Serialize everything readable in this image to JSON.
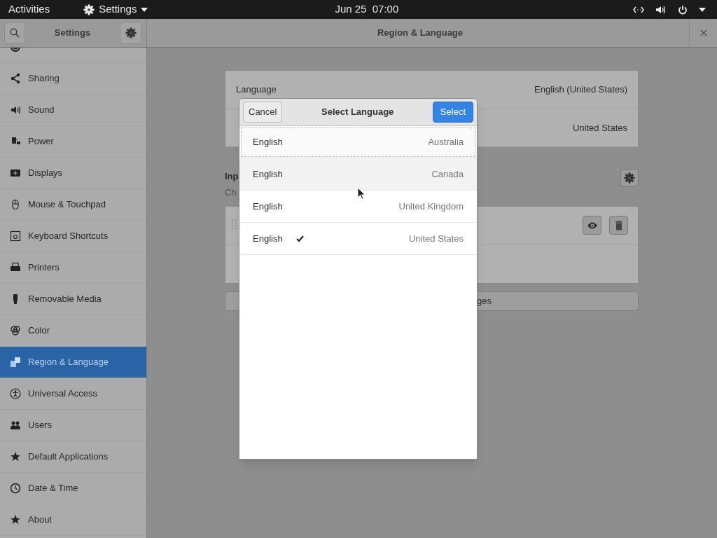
{
  "top_bar": {
    "activities": "Activities",
    "app_menu": "Settings",
    "clock": "Jun 25  07:00"
  },
  "header": {
    "sidebar_title": "Settings",
    "title": "Region & Language"
  },
  "sidebar": {
    "items": [
      {
        "label": "Sharing",
        "selected": false
      },
      {
        "label": "Sound",
        "selected": false
      },
      {
        "label": "Power",
        "selected": false
      },
      {
        "label": "Displays",
        "selected": false
      },
      {
        "label": "Mouse & Touchpad",
        "selected": false
      },
      {
        "label": "Keyboard Shortcuts",
        "selected": false
      },
      {
        "label": "Printers",
        "selected": false
      },
      {
        "label": "Removable Media",
        "selected": false
      },
      {
        "label": "Color",
        "selected": false
      },
      {
        "label": "Region & Language",
        "selected": true
      },
      {
        "label": "Universal Access",
        "selected": false
      },
      {
        "label": "Users",
        "selected": false
      },
      {
        "label": "Default Applications",
        "selected": false
      },
      {
        "label": "Date & Time",
        "selected": false
      },
      {
        "label": "About",
        "selected": false
      }
    ]
  },
  "content": {
    "settings_rows": [
      {
        "label": "Language",
        "value": "English (United States)"
      },
      {
        "value": "United States"
      }
    ],
    "input_heading": "Inp",
    "input_sub": "Ch",
    "bottom_button": "ges"
  },
  "dialog": {
    "cancel": "Cancel",
    "title": "Select Language",
    "select": "Select",
    "rows": [
      {
        "language": "English",
        "region": "Australia",
        "checked": false,
        "focused": true,
        "hovered": false
      },
      {
        "language": "English",
        "region": "Canada",
        "checked": false,
        "focused": false,
        "hovered": true
      },
      {
        "language": "English",
        "region": "United Kingdom",
        "checked": false,
        "focused": false,
        "hovered": false
      },
      {
        "language": "English",
        "region": "United States",
        "checked": true,
        "focused": false,
        "hovered": false
      }
    ]
  }
}
